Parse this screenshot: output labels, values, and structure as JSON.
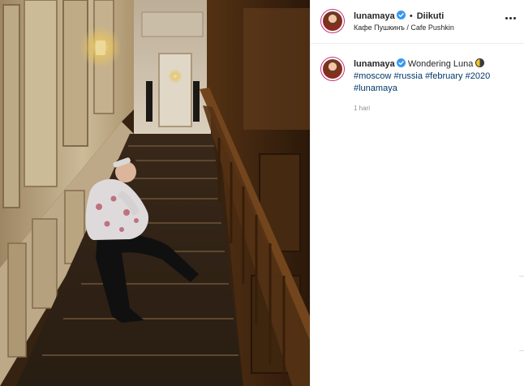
{
  "post": {
    "photo_alt": "",
    "header": {
      "username": "lunamaya",
      "separator": "•",
      "follow_label": "Diikuti",
      "location": "Кафе Пушкинъ / Cafe Pushkin",
      "more_icon": "more-horizontal-icon"
    },
    "caption": {
      "username": "lunamaya",
      "message": "Wondering Luna",
      "emoji": "last-quarter-moon-emoji",
      "hashtags": [
        "#moscow",
        "#russia",
        "#february",
        "#2020",
        "#lunamaya"
      ],
      "time": "1 hari"
    }
  },
  "colors": {
    "avatar_ring": "#c13584",
    "verified": "#3897f0",
    "hashtag": "#00376b",
    "muted": "#8e8e8e",
    "divider": "#efefef"
  }
}
